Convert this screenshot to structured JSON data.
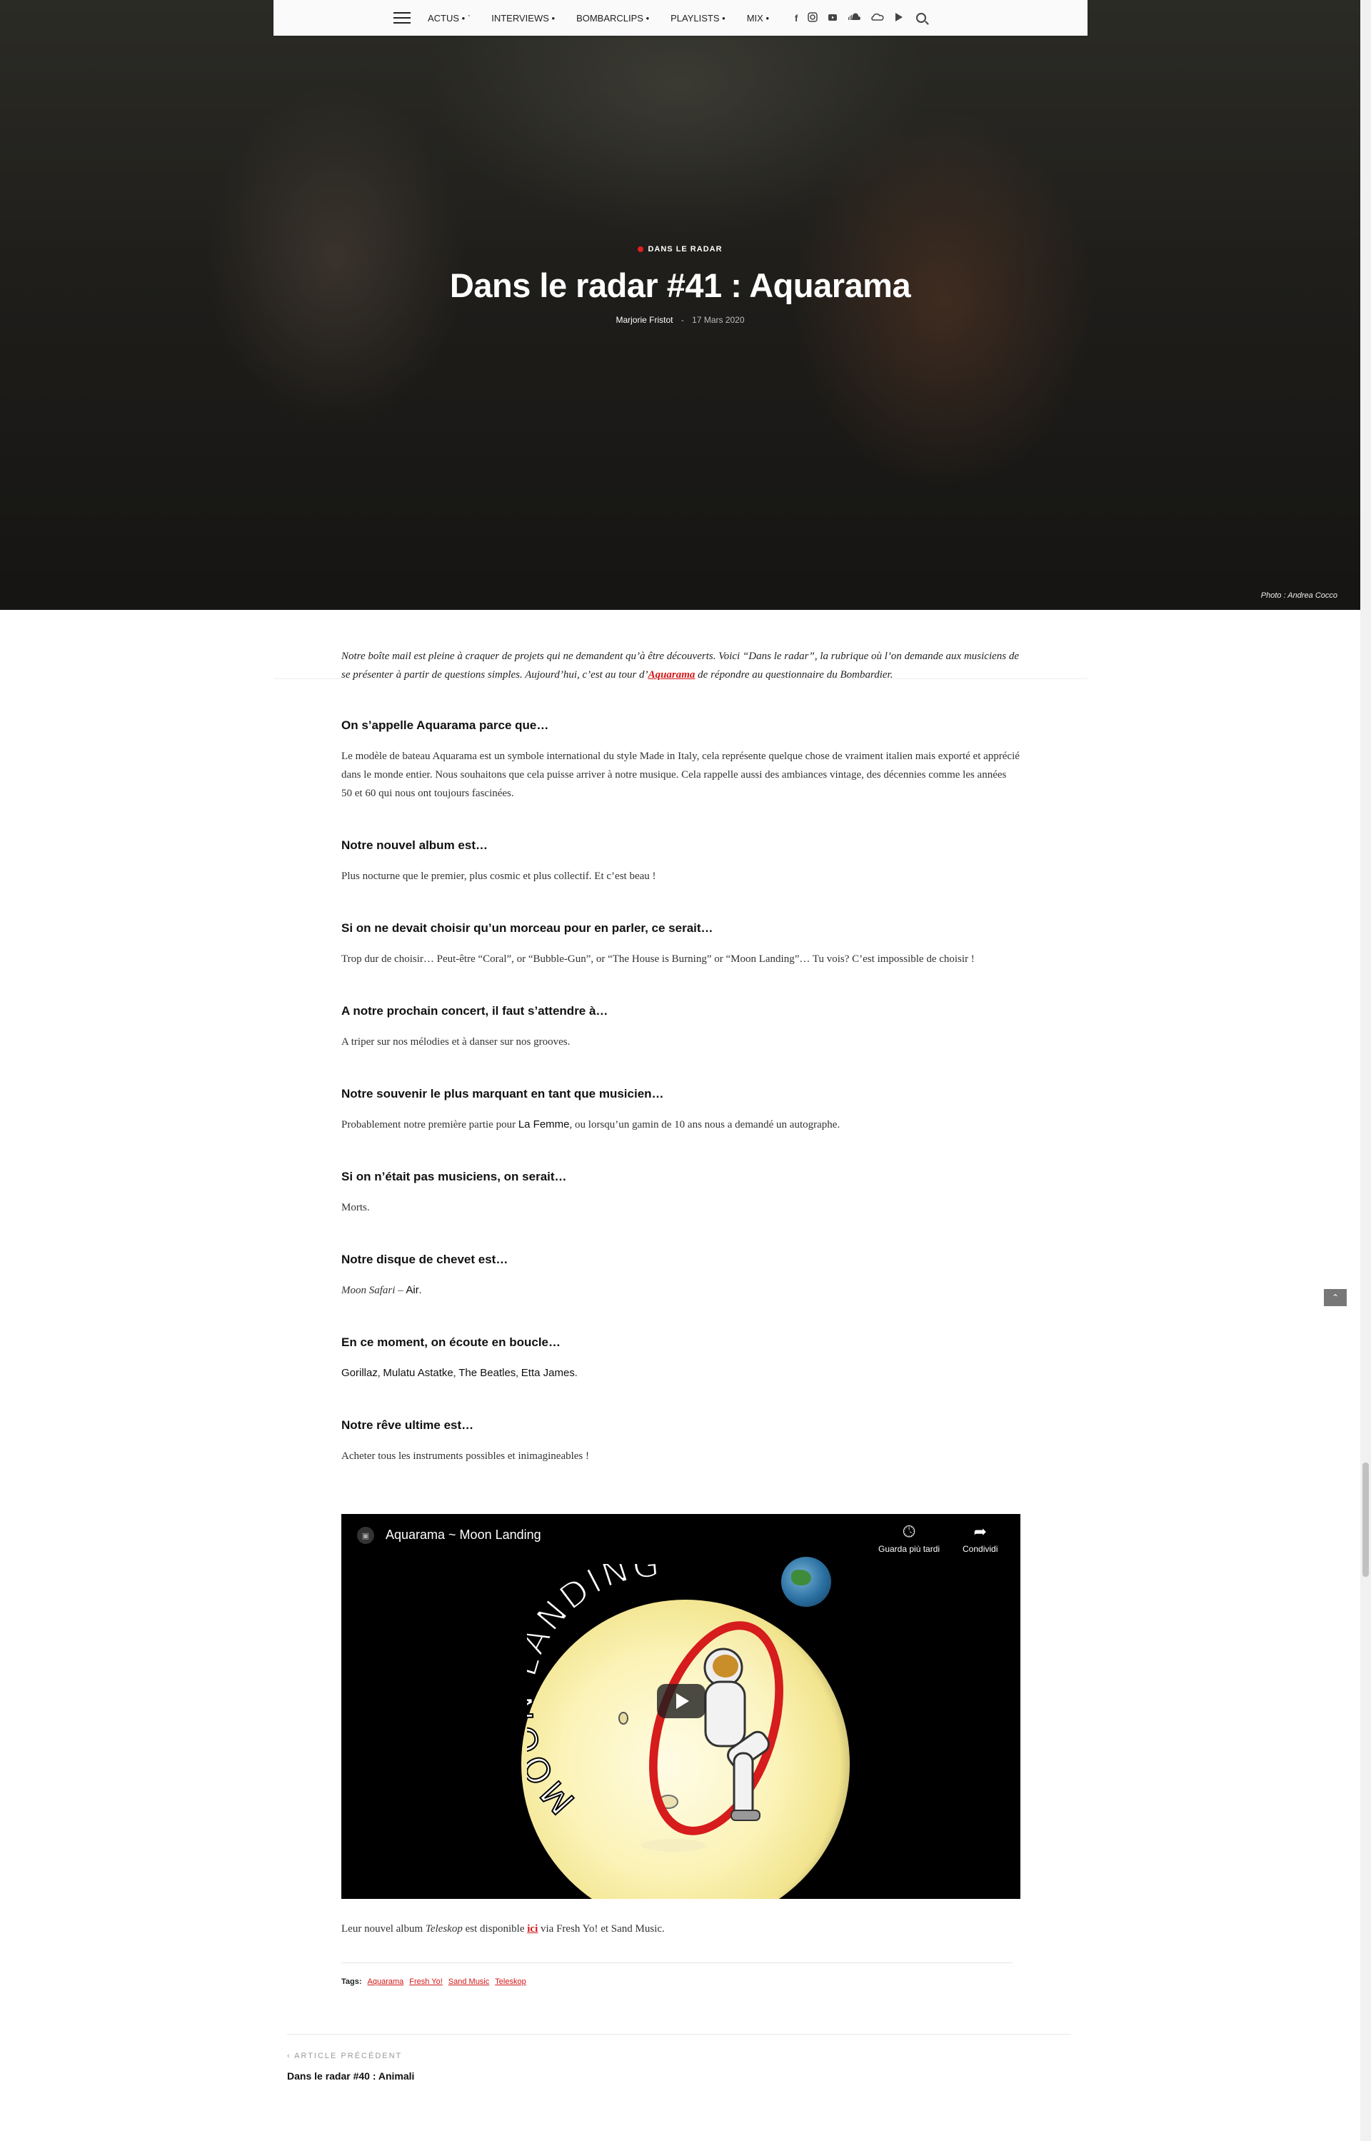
{
  "nav": {
    "items": [
      {
        "label": "ACTUS •",
        "has_chevron": true
      },
      {
        "label": "INTERVIEWS •",
        "has_chevron": false
      },
      {
        "label": "BOMBARCLIPS •",
        "has_chevron": false
      },
      {
        "label": "PLAYLISTS •",
        "has_chevron": false
      },
      {
        "label": "MIX •",
        "has_chevron": false
      }
    ],
    "social_icons": [
      "facebook-icon",
      "instagram-icon",
      "youtube-icon",
      "soundcloud-icon",
      "mixcloud-icon",
      "play-icon"
    ],
    "chevron": "ˇ"
  },
  "hero": {
    "category": "DANS LE RADAR",
    "title": "Dans le radar #41 : Aquarama",
    "author": "Marjorie Fristot",
    "separator": "-",
    "date": "17 Mars 2020",
    "photo_credit": "Photo : Andrea Cocco",
    "accent_color": "#e02020"
  },
  "article": {
    "intro_before": "Notre boîte mail est pleine à craquer de projets qui ne demandent qu’à être découverts. Voici “Dans le radar”, la rubrique où l’on demande aux musiciens de se présenter à partir de questions simples. Aujourd’hui, c’est au tour d’",
    "intro_link": "Aquarama",
    "intro_after": " de répondre au questionnaire du Bombardier.",
    "qa": [
      {
        "q": "On s’appelle Aquarama parce que…",
        "a": "Le modèle de bateau Aquarama est un symbole international du style Made in Italy, cela représente quelque chose de vraiment italien mais exporté et apprécié dans le monde entier. Nous souhaitons que cela puisse arriver à notre musique. Cela rappelle aussi des ambiances vintage, des décennies comme les années 50 et 60 qui nous ont toujours fascinées."
      },
      {
        "q": "Notre nouvel album est…",
        "a": "Plus nocturne que le premier, plus cosmic et plus collectif. Et c’est beau !"
      },
      {
        "q": "Si on ne devait choisir qu’un morceau pour en parler, ce serait…",
        "a": "Trop dur de choisir… Peut-être “Coral”, or “Bubble-Gun”, or “The House is Burning” or “Moon Landing”… Tu vois? C’est impossible de choisir !"
      },
      {
        "q": "A notre prochain concert, il faut s’attendre à…",
        "a": "A triper sur nos mélodies et à danser sur nos grooves."
      }
    ],
    "q5": "Notre souvenir le plus marquant en tant que musicien…",
    "a5_before": "Probablement notre première partie pour ",
    "a5_bold": "La Femme",
    "a5_after": ", ou lorsqu’un gamin de 10 ans nous a demandé un autographe.",
    "q6": "Si on n’était pas musiciens, on serait…",
    "a6": "Morts.",
    "q7": "Notre disque de chevet est…",
    "a7_italic": "Moon Safari",
    "a7_sep": " – ",
    "a7_bold": "Air",
    "a7_end": ".",
    "q8": "En ce moment, on écoute en boucle…",
    "a8": [
      "Gorillaz",
      "Mulatu Astatke",
      "The Beatles",
      "Etta James"
    ],
    "a8_sep": ", ",
    "a8_end": ".",
    "q9": "Notre rêve ultime est…",
    "a9": "Acheter tous les instruments possibles et inimagineables !"
  },
  "video": {
    "title": "Aquarama ~ Moon Landing",
    "watch_later": "Guarda più tardi",
    "share": "Condividi",
    "artwork_text": "MOON LANDING"
  },
  "after_video": {
    "before": "Leur nouvel album ",
    "album": "Teleskop",
    "middle": " est disponible ",
    "link": "ici",
    "after": " via Fresh Yo! et Sand Music."
  },
  "tags": {
    "label": "Tags:",
    "items": [
      "Aquarama",
      "Fresh Yo!",
      "Sand Music",
      "Teleskop"
    ]
  },
  "prev_article": {
    "label": "ARTICLE PRÉCÉDENT",
    "title": "Dans le radar #40 : Animali"
  }
}
